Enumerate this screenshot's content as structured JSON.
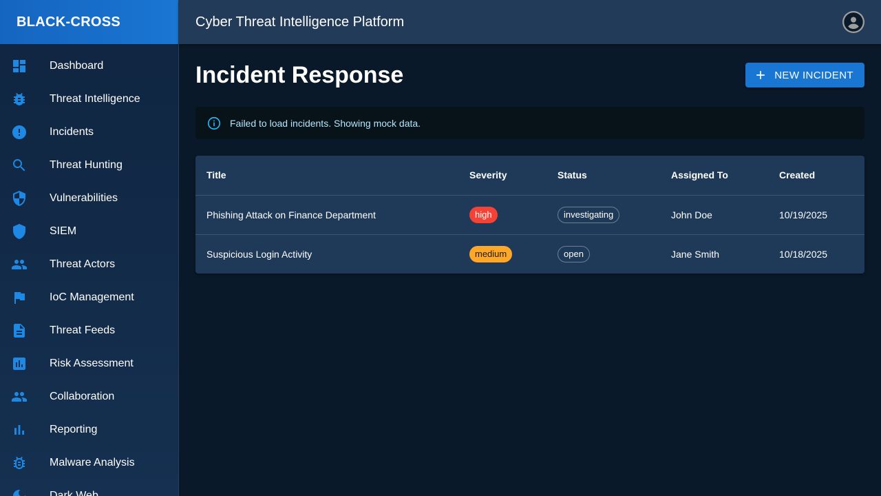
{
  "brand": "BLACK-CROSS",
  "topbar": {
    "title": "Cyber Threat Intelligence Platform"
  },
  "sidebar": {
    "items": [
      {
        "label": "Dashboard",
        "icon": "dashboard-icon"
      },
      {
        "label": "Threat Intelligence",
        "icon": "bug-icon"
      },
      {
        "label": "Incidents",
        "icon": "alert-circle-icon"
      },
      {
        "label": "Threat Hunting",
        "icon": "search-icon"
      },
      {
        "label": "Vulnerabilities",
        "icon": "shield-half-icon"
      },
      {
        "label": "SIEM",
        "icon": "shield-icon"
      },
      {
        "label": "Threat Actors",
        "icon": "people-icon"
      },
      {
        "label": "IoC Management",
        "icon": "flag-icon"
      },
      {
        "label": "Threat Feeds",
        "icon": "document-icon"
      },
      {
        "label": "Risk Assessment",
        "icon": "assessment-icon"
      },
      {
        "label": "Collaboration",
        "icon": "group-icon"
      },
      {
        "label": "Reporting",
        "icon": "bar-chart-icon"
      },
      {
        "label": "Malware Analysis",
        "icon": "bug-report-icon"
      },
      {
        "label": "Dark Web",
        "icon": "moon-icon"
      }
    ]
  },
  "main": {
    "title": "Incident Response",
    "new_button_label": "NEW INCIDENT",
    "alert_text": "Failed to load incidents. Showing mock data.",
    "table": {
      "headers": [
        "Title",
        "Severity",
        "Status",
        "Assigned To",
        "Created"
      ],
      "rows": [
        {
          "title": "Phishing Attack on Finance Department",
          "severity": "high",
          "status": "investigating",
          "assigned": "John Doe",
          "created": "10/19/2025"
        },
        {
          "title": "Suspicious Login Activity",
          "severity": "medium",
          "status": "open",
          "assigned": "Jane Smith",
          "created": "10/18/2025"
        }
      ]
    }
  },
  "colors": {
    "accent": "#1976d2",
    "high": "#f44336",
    "medium": "#ffa726",
    "info": "#29b6f6"
  }
}
